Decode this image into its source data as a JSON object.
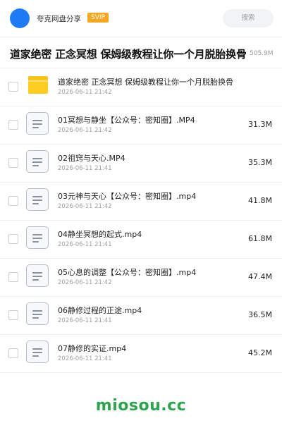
{
  "header": {
    "brand": "夸克网盘分享",
    "badge": "SVIP",
    "search_label": "搜索"
  },
  "folder": {
    "title": "道家绝密 正念冥想 保姆级教程让你一个月脱胎换骨",
    "total_size": "505.9M"
  },
  "items": [
    {
      "type": "folder",
      "icon": "folder-icon",
      "name": "道家绝密 正念冥想 保姆级教程让你一个月脱胎换骨",
      "date": "2026-06-11 21:42",
      "size": ""
    },
    {
      "type": "file",
      "icon": "document-icon",
      "name": "01冥想与静坐【公众号：密知圈】.MP4",
      "date": "2026-06-11 21:42",
      "size": "31.3M"
    },
    {
      "type": "file",
      "icon": "document-icon",
      "name": "02祖窍与天心.MP4",
      "date": "2026-06-11 21:41",
      "size": "35.3M"
    },
    {
      "type": "file",
      "icon": "document-icon",
      "name": "03元神与天心【公众号：密知圈】.mp4",
      "date": "2026-06-11 21:42",
      "size": "41.8M"
    },
    {
      "type": "file",
      "icon": "document-icon",
      "name": "04静坐冥想的起式.mp4",
      "date": "2026-06-11 21:41",
      "size": "61.8M"
    },
    {
      "type": "file",
      "icon": "document-icon",
      "name": "05心息的调整【公众号：密知圈】.mp4",
      "date": "2026-06-11 21:42",
      "size": "47.4M"
    },
    {
      "type": "file",
      "icon": "document-icon",
      "name": "06静修过程的正途.mp4",
      "date": "2026-06-11 21:41",
      "size": "36.5M"
    },
    {
      "type": "file",
      "icon": "document-icon",
      "name": "07静修的实证.mp4",
      "date": "2026-06-11 21:41",
      "size": "45.2M"
    }
  ],
  "watermark": "miosou.cc",
  "colors": {
    "brand_blue": "#1e7bf5",
    "svip_orange": "#f5a623",
    "folder_yellow": "#ffcc20",
    "watermark_green": "#2ea44f"
  }
}
